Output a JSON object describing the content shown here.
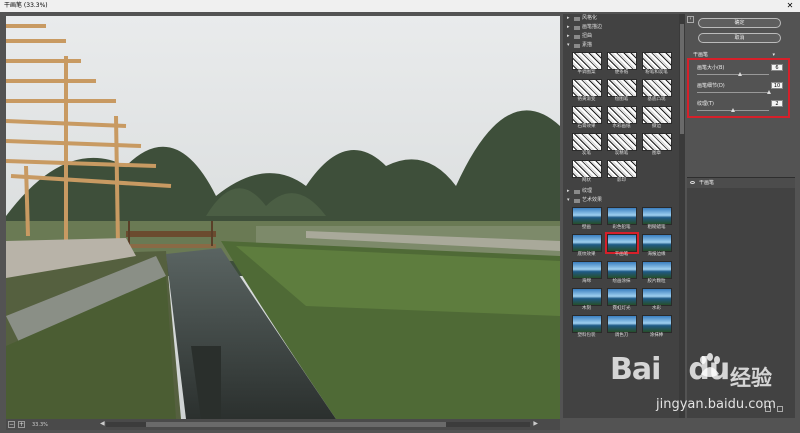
{
  "window": {
    "title": "干画笔 (33.3%)",
    "close_glyph": "✕"
  },
  "status": {
    "zoom": "33.3%",
    "minus": "−",
    "plus": "+",
    "scroll_left": "◀",
    "scroll_right": "▶"
  },
  "gallery": {
    "categories": [
      {
        "label": "风格化",
        "expanded": false
      },
      {
        "label": "画笔描边",
        "expanded": false
      },
      {
        "label": "扭曲",
        "expanded": false
      },
      {
        "label": "素描",
        "expanded": true
      },
      {
        "label": "纹理",
        "expanded": false
      },
      {
        "label": "艺术效果",
        "expanded": true
      }
    ],
    "sketch_items": [
      "半调图案",
      "便条纸",
      "粉笔和炭笔",
      "铬黄渐变",
      "绘图笔",
      "基底凸现",
      "石膏效果",
      "水彩画纸",
      "撕边",
      "炭笔",
      "炭精笔",
      "图章",
      "网状",
      "影印"
    ],
    "art_items": [
      "壁画",
      "彩色铅笔",
      "粗糙蜡笔",
      "底纹效果",
      "干画笔",
      "海报边缘",
      "海绵",
      "绘画涂抹",
      "胶片颗粒",
      "木刻",
      "霓虹灯光",
      "水彩",
      "塑料包装",
      "调色刀",
      "涂抹棒"
    ],
    "selected": "干画笔"
  },
  "panel": {
    "ok_label": "确定",
    "cancel_label": "取消",
    "filter_name": "干画笔",
    "params": [
      {
        "label": "画笔大小(B)",
        "value": "6",
        "fraction": 0.6
      },
      {
        "label": "画笔细节(D)",
        "value": "10",
        "fraction": 1.0
      },
      {
        "label": "纹理(T)",
        "value": "2",
        "fraction": 0.5
      }
    ],
    "layer_name": "干画笔"
  },
  "watermark": {
    "brand": "Bai",
    "brand_tail": "du",
    "cn": "经验",
    "url": "jingyan.baidu.com"
  },
  "colors": {
    "highlight": "#d6202a"
  }
}
